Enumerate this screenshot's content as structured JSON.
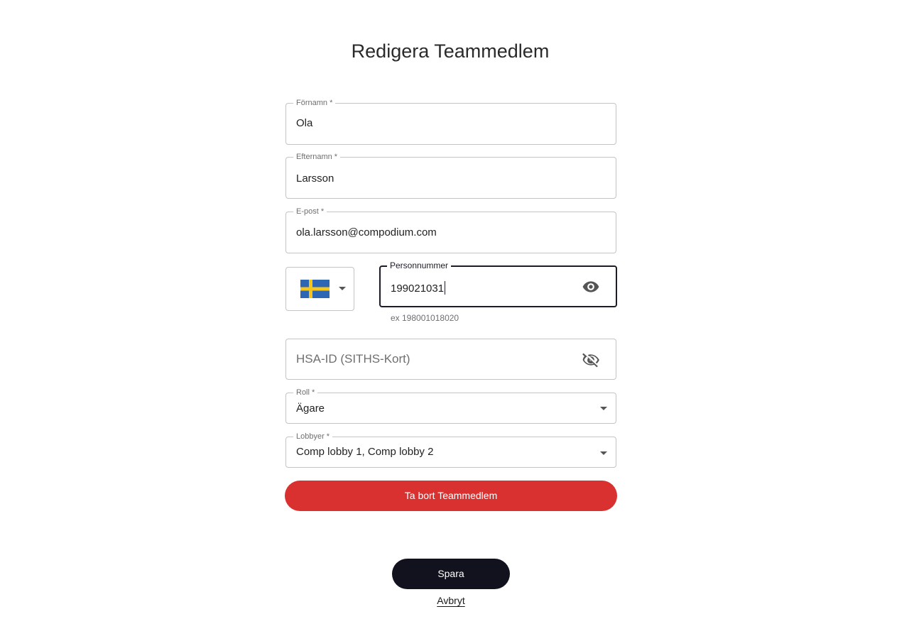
{
  "page": {
    "title": "Redigera Teammedlem"
  },
  "form": {
    "first_name": {
      "label": "Förnamn *",
      "value": "Ola"
    },
    "last_name": {
      "label": "Efternamn *",
      "value": "Larsson"
    },
    "email": {
      "label": "E-post *",
      "value": "ola.larsson@compodium.com"
    },
    "country": {
      "flag": "sweden-flag-icon",
      "colors": {
        "blue": "#2f66b3",
        "yellow": "#f5c518"
      }
    },
    "personal_number": {
      "label": "Personnummer",
      "value": "199021031",
      "helper": "ex 198001018020",
      "visibility_icon": "eye-icon"
    },
    "hsa_id": {
      "placeholder": "HSA-ID (SITHS-Kort)",
      "visibility_icon": "eye-off-icon"
    },
    "role": {
      "label": "Roll *",
      "value": "Ägare"
    },
    "lobbies": {
      "label": "Lobbyer *",
      "value": "Comp lobby 1, Comp lobby 2"
    }
  },
  "actions": {
    "delete_label": "Ta bort Teammedlem",
    "save_label": "Spara",
    "cancel_label": "Avbryt"
  },
  "colors": {
    "danger": "#d93030",
    "primary": "#12121f",
    "border": "#c4c4c4"
  }
}
